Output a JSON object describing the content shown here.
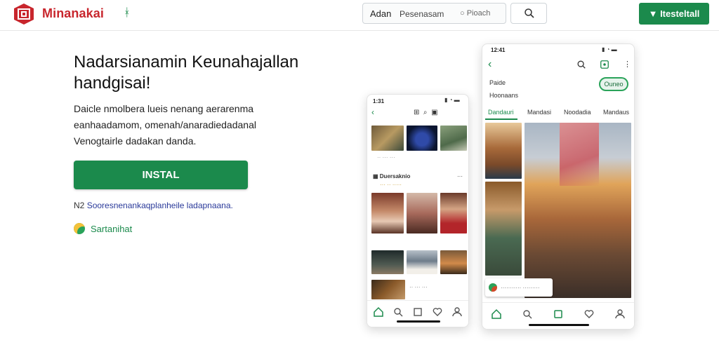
{
  "header": {
    "brand": "Minanakai",
    "brand_glyph": "ᚼ",
    "search": {
      "left_text": "Adan",
      "mid_text": "Pesenasam",
      "right_text": "Pioach"
    },
    "cta_label": "Itesteltall"
  },
  "hero": {
    "headline": "Nadarsianamin Keunahajallan handgisai!",
    "description": "Daicle nmolbera lueis nenang aerarenma eanhaadamom, omenah/anaradiedadanal Venogtairle dadakan danda.",
    "install_label": "INSTAL",
    "note_prefix": "N2",
    "note_text": "Sooresnenankaqplanheile ladapnaana.",
    "extra_label": "Sartanihat"
  },
  "phone_small": {
    "status_time": "1:31",
    "section_title": "Duersaknio",
    "section_meta": "··· ·· ·····",
    "caption_row": "·· ··· ···"
  },
  "phone_large": {
    "status_time": "12:41",
    "title": "Paide",
    "subtitle": "Hoonaans",
    "pill_label": "Ouneo",
    "tabs": [
      "Dandauri",
      "Mandasi",
      "Noodadia",
      "Mandaus"
    ],
    "chip_text": "··········· ·········"
  },
  "colors": {
    "brand_red": "#c8262d",
    "accent_green": "#1b8a4c"
  },
  "icons": [
    "logo-emblem",
    "search-icon",
    "back-arrow-icon",
    "more-icon",
    "home-icon",
    "heart-icon",
    "profile-icon",
    "grid-icon"
  ]
}
